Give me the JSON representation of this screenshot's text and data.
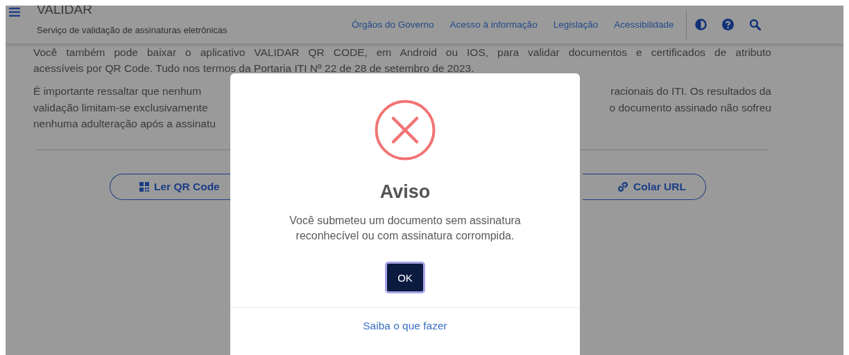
{
  "header": {
    "title": "VALIDAR",
    "subtitle": "Serviço de validação de assinaturas eletrônicas",
    "nav_links": [
      "Órgãos do Governo",
      "Acesso à informação",
      "Legislação",
      "Acessibilidade"
    ]
  },
  "content": {
    "paragraph_1_lines": [
      "Você também pode baixar o aplicativo VALIDAR QR CODE, em Android ou IOS, para validar documentos e certificados de atributo",
      "acessíveis por QR Code. Tudo nos termos da Portaria ITI Nº 22 de 28 de setembro de 2023."
    ],
    "paragraph_2_lines": [
      {
        "left": "É importante ressaltar que nenhum",
        "right": "racionais do ITI. Os resultados da"
      },
      {
        "left": "validação limitam-se exclusivamente",
        "right": "o documento assinado não sofreu"
      },
      {
        "left": "nenhuma adulteração após a assinatu"
      }
    ],
    "buttons": [
      {
        "label": "Ler QR Code",
        "kind": "scan"
      },
      {
        "label": "Colar URL",
        "kind": "paste"
      }
    ]
  },
  "dialog": {
    "title": "Aviso",
    "message": "Você submeteu um documento sem assinatura reconhecível ou com assinatura corrompida.",
    "button": "OK",
    "footer_link": "Saiba o que fazer"
  }
}
